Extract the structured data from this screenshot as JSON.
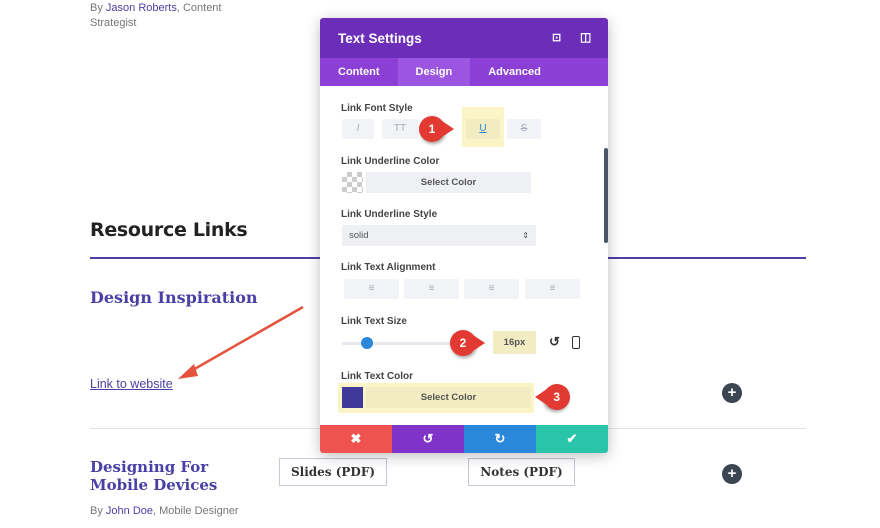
{
  "page": {
    "byline_top": {
      "prefix": "By ",
      "author": "Jason Roberts",
      "suffix": ", Content",
      "line2": "Strategist"
    },
    "section_title": "Resource Links",
    "item1": {
      "title": "Design Inspiration",
      "link": "Link to website"
    },
    "item2": {
      "title_line1": "Designing For",
      "title_line2": "Mobile Devices",
      "slides": "Slides (PDF)",
      "notes": "Notes (PDF)",
      "byline_prefix": "By ",
      "author": "John Doe",
      "byline_suffix": ", Mobile Designer"
    },
    "plus_icon": "+"
  },
  "panel": {
    "title": "Text Settings",
    "tabs": [
      {
        "label": "Content"
      },
      {
        "label": "Design",
        "active": true
      },
      {
        "label": "Advanced"
      }
    ],
    "link_font_style": {
      "label": "Link Font Style",
      "buttons": [
        "I",
        "TT",
        "U",
        "S"
      ],
      "active": "U"
    },
    "underline_color": {
      "label": "Link Underline Color",
      "button": "Select Color"
    },
    "underline_style": {
      "label": "Link Underline Style",
      "value": "solid"
    },
    "alignment": {
      "label": "Link Text Alignment"
    },
    "text_size": {
      "label": "Link Text Size",
      "value": "16px",
      "slider_percent": 25
    },
    "text_color": {
      "label": "Link Text Color",
      "button": "Select Color",
      "swatch": "#3f3a9a"
    },
    "footer": {
      "cancel": "✖",
      "undo": "↺",
      "redo": "↻",
      "save": "✔"
    },
    "callouts": [
      "1",
      "2",
      "3"
    ]
  },
  "colors": {
    "header": "#6c2eb9",
    "tabs": "#8b3fd5",
    "cancel": "#ef5350",
    "undo": "#8033c9",
    "redo": "#2b87da",
    "save": "#29c4a9",
    "highlight": "#fbf4c6",
    "link": "#4b3fa5"
  }
}
